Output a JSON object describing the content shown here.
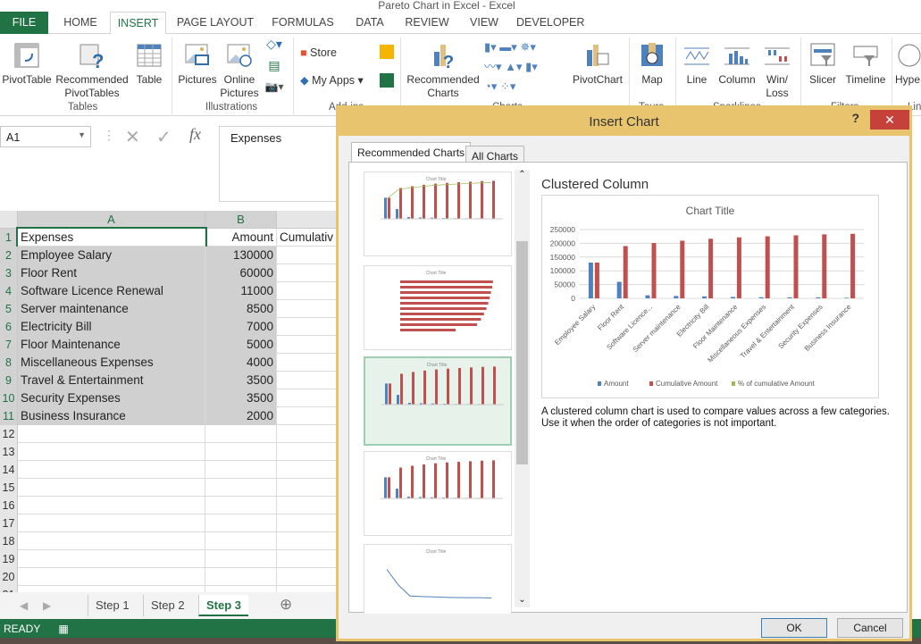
{
  "window": {
    "title": "Pareto Chart in Excel - Excel"
  },
  "ribbon_tabs": [
    "FILE",
    "HOME",
    "INSERT",
    "PAGE LAYOUT",
    "FORMULAS",
    "DATA",
    "REVIEW",
    "VIEW",
    "DEVELOPER"
  ],
  "ribbon": {
    "pivottable": "PivotTable",
    "rec_pivot_1": "Recommended",
    "rec_pivot_2": "PivotTables",
    "table": "Table",
    "tables_group": "Tables",
    "pictures": "Pictures",
    "online_1": "Online",
    "online_2": "Pictures",
    "illustrations_group": "Illustrations",
    "store": "Store",
    "myapps": "My Apps",
    "addins_group": "Add-ins",
    "rec_charts_1": "Recommended",
    "rec_charts_2": "Charts",
    "charts_group": "Charts",
    "pivotchart": "PivotChart",
    "map": "Map",
    "tours_group": "Tours",
    "line": "Line",
    "column": "Column",
    "winloss_1": "Win/",
    "winloss_2": "Loss",
    "sparklines_group": "Sparklines",
    "slicer": "Slicer",
    "timeline": "Timeline",
    "filters_group": "Filters",
    "hyperlink": "Hype",
    "links_group": "Lin"
  },
  "formula_bar": {
    "name_box": "A1",
    "content": "Expenses"
  },
  "sheet": {
    "columns": [
      "A",
      "B"
    ],
    "partial_header": "Cumulativ",
    "rows": [
      [
        "Expenses",
        "Amount"
      ],
      [
        "Employee Salary",
        "130000"
      ],
      [
        "Floor Rent",
        "60000"
      ],
      [
        "Software Licence Renewal",
        "11000"
      ],
      [
        "Server maintenance",
        "8500"
      ],
      [
        "Electricity Bill",
        "7000"
      ],
      [
        "Floor Maintenance",
        "5000"
      ],
      [
        "Miscellaneous Expenses",
        "4000"
      ],
      [
        "Travel & Entertainment",
        "3500"
      ],
      [
        "Security Expenses",
        "3500"
      ],
      [
        "Business Insurance",
        "2000"
      ]
    ],
    "row_numbers": [
      "1",
      "2",
      "3",
      "4",
      "5",
      "6",
      "7",
      "8",
      "9",
      "10",
      "11",
      "12",
      "13",
      "14",
      "15",
      "16",
      "17",
      "18",
      "19",
      "20",
      "21"
    ],
    "tabs": [
      "Step 1",
      "Step 2",
      "Step 3"
    ],
    "active_tab": "Step 3"
  },
  "status": {
    "text": "READY"
  },
  "dialog": {
    "title": "Insert Chart",
    "help": "?",
    "close": "✕",
    "tabs": [
      "Recommended Charts",
      "All Charts"
    ],
    "selected_name": "Clustered Column",
    "description": "A clustered column chart is used to compare values across a few categories. Use it when the order of categories is not important.",
    "ok": "OK",
    "cancel": "Cancel"
  },
  "chart_data": {
    "type": "bar",
    "title": "Chart Title",
    "categories": [
      "Employee Salary",
      "Floor Rent",
      "Software Licence...",
      "Server maintenance",
      "Electricity Bill",
      "Floor Maintenance",
      "Miscellaneous Expenses",
      "Travel & Entertainment",
      "Security Expenses",
      "Business Insurance"
    ],
    "series": [
      {
        "name": "Amount",
        "color": "#4f81bd",
        "values": [
          130000,
          60000,
          11000,
          8500,
          7000,
          5000,
          4000,
          3500,
          3500,
          2000
        ]
      },
      {
        "name": "Cumulative Amount",
        "color": "#c0504d",
        "values": [
          130000,
          190000,
          201000,
          209500,
          216500,
          221500,
          225500,
          229000,
          232500,
          234500
        ]
      },
      {
        "name": "% of cumulative Amount",
        "color": "#9bbb59",
        "values": []
      }
    ],
    "yticks": [
      "0",
      "50000",
      "100000",
      "150000",
      "200000",
      "250000"
    ],
    "ylim": [
      0,
      250000
    ],
    "grid": true,
    "legend": "bottom"
  },
  "colors": {
    "excel_green": "#217346",
    "dialog_border": "#e8c46e",
    "close_red": "#c7413b"
  }
}
